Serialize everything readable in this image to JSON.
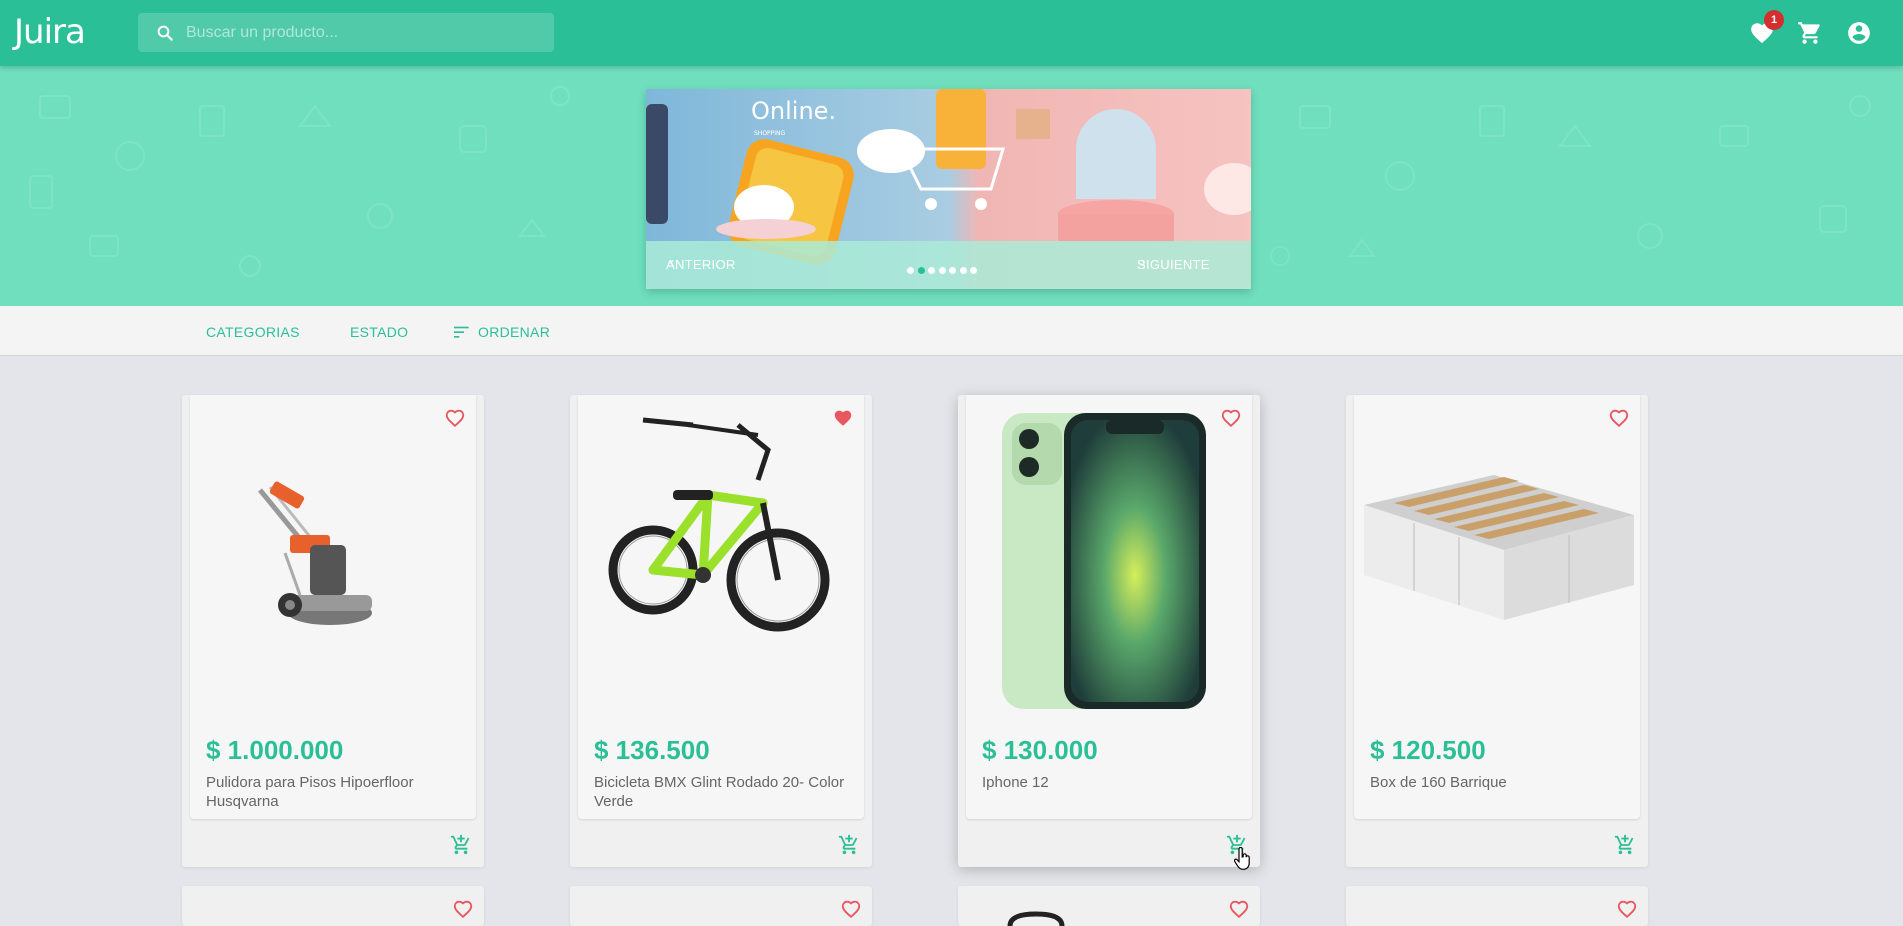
{
  "header": {
    "logo": "Juira",
    "search_placeholder": "Buscar un producto...",
    "favorites_count": "1",
    "icons": [
      "favorites-heart-icon",
      "cart-icon",
      "account-icon"
    ]
  },
  "carousel": {
    "banner_title": "Online.",
    "banner_subtitle": "SHOPPING",
    "prev_label": "ANTERIOR",
    "next_label": "SIGUIENTE",
    "slide_count": 7,
    "active_slide": 2
  },
  "filters": {
    "categories": "CATEGORIAS",
    "state": "ESTADO",
    "order": "ORDENAR"
  },
  "products": [
    {
      "price": "$ 1.000.000",
      "title": "Pulidora para Pisos Hipoerfloor Husqvarna",
      "favorite": false,
      "image": "floor-polisher-image"
    },
    {
      "price": "$ 136.500",
      "title": "Bicicleta BMX Glint Rodado 20- Color Verde",
      "favorite": true,
      "image": "bmx-bicycle-image"
    },
    {
      "price": "$ 130.000",
      "title": "Iphone 12",
      "favorite": false,
      "image": "iphone-12-image"
    },
    {
      "price": "$ 120.500",
      "title": "Box de 160 Barrique",
      "favorite": false,
      "image": "bed-box-image"
    }
  ],
  "colors": {
    "primary": "#2bbf97",
    "hero": "#6fdfbe",
    "favorite": "#e8575f",
    "badge": "#d32f2f"
  }
}
